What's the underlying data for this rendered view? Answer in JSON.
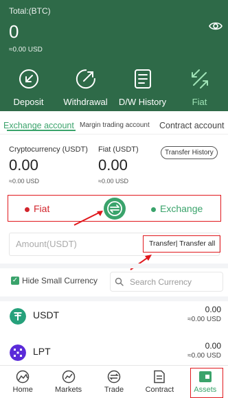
{
  "header": {
    "total_label": "Total:(BTC)",
    "total_value": "0",
    "total_fiat": "≈0.00 USD",
    "actions": [
      {
        "label": "Deposit",
        "icon": "deposit-icon"
      },
      {
        "label": "Withdrawal",
        "icon": "withdrawal-icon"
      },
      {
        "label": "D/W History",
        "icon": "history-icon"
      },
      {
        "label": "Fiat",
        "icon": "transfer-arrows-icon"
      }
    ]
  },
  "tabs": [
    "Exchange account",
    "Margin trading account",
    "Contract account"
  ],
  "balances": {
    "crypto_label": "Cryptocurrency (USDT)",
    "crypto_value": "0.00",
    "crypto_fiat": "≈0.00 USD",
    "fiat_label": "Fiat (USDT)",
    "fiat_value": "0.00",
    "fiat_fiat": "≈0.00 USD",
    "transfer_history": "Transfer History"
  },
  "swap": {
    "left": "Fiat",
    "right": "Exchange"
  },
  "amount": {
    "placeholder": "Amount(USDT)",
    "actions": "Transfer| Transfer all"
  },
  "filters": {
    "hide_small": "Hide Small Currency",
    "search_placeholder": "Search Currency"
  },
  "currencies": [
    {
      "name": "USDT",
      "amount": "0.00",
      "fiat": "≈0.00 USD",
      "color": "#26a17b"
    },
    {
      "name": "LPT",
      "amount": "0.00",
      "fiat": "≈0.00 USD",
      "color": "#5b2bd9"
    }
  ],
  "nav": [
    "Home",
    "Markets",
    "Trade",
    "Contract",
    "Assets"
  ],
  "colors": {
    "brand": "#2e6a48",
    "accent": "#3aa36b",
    "red": "#d2252c",
    "highlight": "#e0171c"
  }
}
